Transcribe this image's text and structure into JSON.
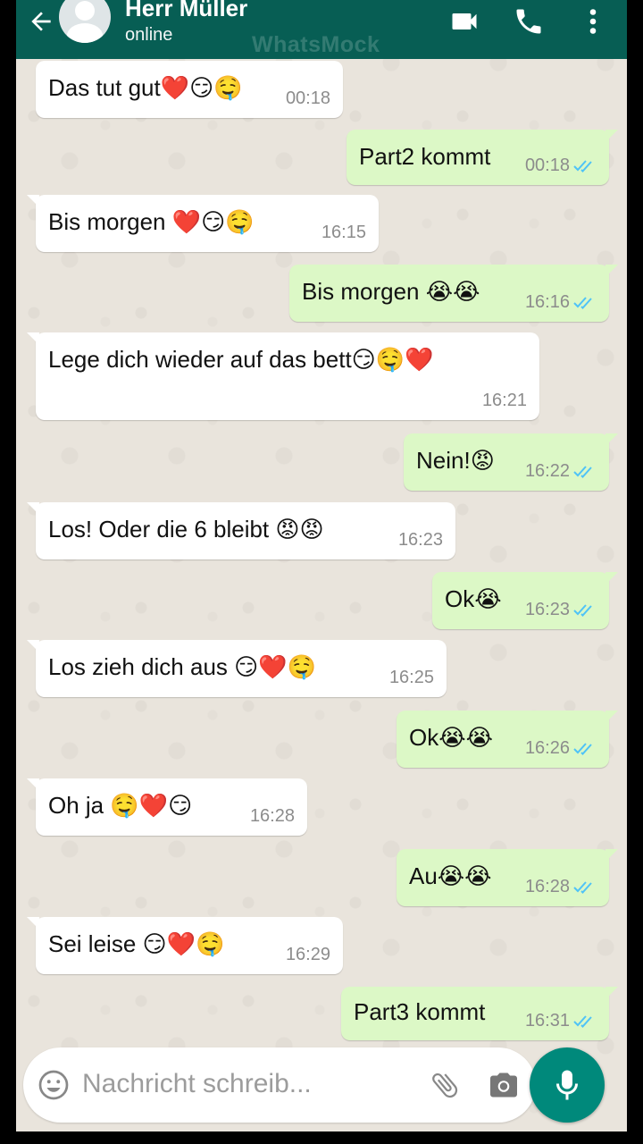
{
  "header": {
    "contact_name": "Herr Müller",
    "status": "online",
    "watermark": "WhatsMock"
  },
  "colors": {
    "header": "#075e54",
    "incoming_bubble": "#ffffff",
    "outgoing_bubble": "#dcf8c6",
    "read_ticks": "#4fc3f7",
    "mic_button": "#00897b"
  },
  "messages": [
    {
      "direction": "in",
      "text": "Das tut gut❤️😏🤤",
      "time": "00:18"
    },
    {
      "direction": "out",
      "text": "Part2 kommt",
      "time": "00:18",
      "status": "read"
    },
    {
      "direction": "in",
      "text": "Bis morgen ❤️😏🤤",
      "time": "16:15"
    },
    {
      "direction": "out",
      "text": "Bis morgen 😭😭",
      "time": "16:16",
      "status": "read"
    },
    {
      "direction": "in",
      "text": "Lege dich wieder auf das bett😏🤤❤️",
      "time": "16:21"
    },
    {
      "direction": "out",
      "text": "Nein!😡",
      "time": "16:22",
      "status": "read"
    },
    {
      "direction": "in",
      "text": "Los! Oder die 6 bleibt 😡😡",
      "time": "16:23"
    },
    {
      "direction": "out",
      "text": "Ok😭",
      "time": "16:23",
      "status": "read"
    },
    {
      "direction": "in",
      "text": "Los zieh dich aus 😏❤️🤤",
      "time": "16:25"
    },
    {
      "direction": "out",
      "text": "Ok😭😭",
      "time": "16:26",
      "status": "read"
    },
    {
      "direction": "in",
      "text": "Oh ja 🤤❤️😏",
      "time": "16:28"
    },
    {
      "direction": "out",
      "text": "Au😭😭",
      "time": "16:28",
      "status": "read"
    },
    {
      "direction": "in",
      "text": "Sei leise 😏❤️🤤",
      "time": "16:29"
    },
    {
      "direction": "out",
      "text": "Part3 kommt",
      "time": "16:31",
      "status": "read"
    }
  ],
  "composer": {
    "placeholder": "Nachricht schreib..."
  }
}
